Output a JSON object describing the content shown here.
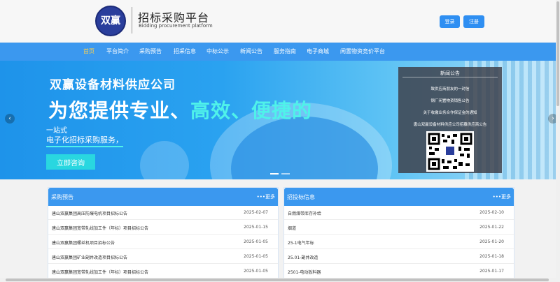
{
  "header": {
    "logo_text": "双赢",
    "title": "招标采购平台",
    "subtitle": "Bidding procurement platform",
    "login_label": "登录",
    "register_label": "注册"
  },
  "nav": {
    "items": [
      {
        "label": "首页",
        "active": true
      },
      {
        "label": "平台简介"
      },
      {
        "label": "采购预告"
      },
      {
        "label": "招采信息"
      },
      {
        "label": "中标公示"
      },
      {
        "label": "新闻公告"
      },
      {
        "label": "服务指南"
      },
      {
        "label": "电子商城"
      },
      {
        "label": "闲置物资竞价平台"
      }
    ]
  },
  "banner": {
    "company": "双赢设备材料供应公司",
    "slogan_prefix": "为您提供专业、",
    "slogan_highlight": "高效、便捷的",
    "line1": "一站式",
    "line2": "电子化招标采购服务，",
    "consult_label": "立即咨询"
  },
  "news_box": {
    "title": "新闻公告",
    "items": [
      "致供应商朋友的一封信",
      "钢厂闲置物资销售公告",
      "关于收缴业务合作保证金的通知",
      "唐山双赢设备材料供应公司招募供应商公告"
    ]
  },
  "procurement_preview": {
    "title": "采购预告",
    "more_label": "•••更多",
    "rows": [
      {
        "title": "唐山双赢集团高压防爆电机项目招标公告",
        "date": "2025-02-07"
      },
      {
        "title": "唐山双赢集团宽带轧线加工件（年标）项目招标公告",
        "date": "2025-01-15"
      },
      {
        "title": "唐山双赢集团螺丝机项目招标公告",
        "date": "2025-01-05"
      },
      {
        "title": "唐山双赢集团矿业副井改造项目招标公告",
        "date": "2025-01-05"
      },
      {
        "title": "唐山双赢集团宽带轧线加工件（年标）项目招标公告",
        "date": "2025-01-05"
      }
    ]
  },
  "bidding_info": {
    "title": "招投标信息",
    "more_label": "•••更多",
    "rows": [
      {
        "title": "自燃煤带库存补给",
        "date": "2025-02-10"
      },
      {
        "title": "烟道",
        "date": "2025-01-22"
      },
      {
        "title": "25-1电气年标",
        "date": "2025-01-20"
      },
      {
        "title": "25.01-副井改造",
        "date": "2025-01-18"
      },
      {
        "title": "2501-电动扳料器",
        "date": "2025-01-17"
      }
    ]
  },
  "colors": {
    "accent": "#3b98ef",
    "nav_active": "#ffd24c",
    "highlight": "#4ff2ea"
  }
}
